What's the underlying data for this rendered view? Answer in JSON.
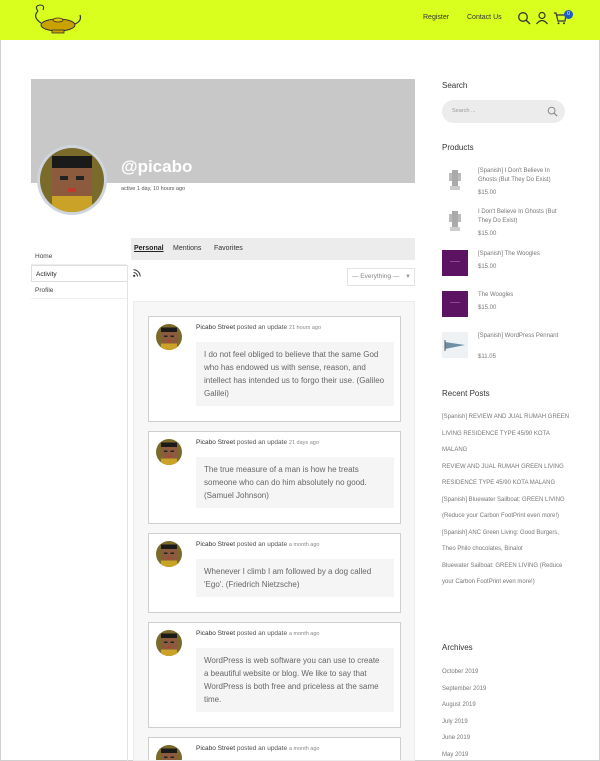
{
  "header": {
    "register_label": "Register",
    "contact_label": "Contact Us",
    "cart_count": "0"
  },
  "profile": {
    "username": "@picabo",
    "active": "active 1 day, 10 hours ago"
  },
  "side_menu": [
    "Home",
    "Activity",
    "Profile"
  ],
  "subnav": {
    "personal": "Personal",
    "mentions": "Mentions",
    "favorites": "Favorites"
  },
  "filter": {
    "value": "— Everything —"
  },
  "activity": [
    {
      "name": "Picabo Street",
      "action": "posted an update",
      "time": "21 hours ago",
      "text": "I do not feel obliged to believe that the same God who has endowed us with sense, reason, and intellect has intended us to forgo their use. (Galileo Galilei)"
    },
    {
      "name": "Picabo Street",
      "action": "posted an update",
      "time": "21 days ago",
      "text": "The true measure of a man is how he treats someone who can do him absolutely no good. (Samuel Johnson)"
    },
    {
      "name": "Picabo Street",
      "action": "posted an update",
      "time": "a month ago",
      "text": "Whenever I climb I am followed by a dog called 'Ego'. (Friedrich Nietzsche)"
    },
    {
      "name": "Picabo Street",
      "action": "posted an update",
      "time": "a month ago",
      "text": "WordPress is web software you can use to create a beautiful website or blog. We like to say that WordPress is both free and priceless at the same time."
    },
    {
      "name": "Picabo Street",
      "action": "posted an update",
      "time": "a month ago",
      "text": ""
    }
  ],
  "sidebar": {
    "search_title": "Search",
    "search_placeholder": "Search ...",
    "products_title": "Products",
    "products": [
      {
        "name": "[Spanish] I Don't Believe In Ghosts (But They Do Exist)",
        "price": "$15.00",
        "thumb": "figure"
      },
      {
        "name": "I Don't Believe In Ghosts (But They Do Exist)",
        "price": "$15.00",
        "thumb": "figure"
      },
      {
        "name": "[Spanish] The Woogles",
        "price": "$15.00",
        "thumb": "purple"
      },
      {
        "name": "The Woogles",
        "price": "$15.00",
        "thumb": "purple"
      },
      {
        "name": "[Spanish] WordPress Pennant",
        "price": "$11.05",
        "thumb": "pennant"
      }
    ],
    "recent_title": "Recent Posts",
    "recent_posts": [
      "[Spanish] REVIEW AND JUAL RUMAH GREEN LIVING RESIDENCE TYPE 45/90 KOTA MALANG",
      "REVIEW AND JUAL RUMAH GREEN LIVING RESIDENCE TYPE 45/90 KOTA MALANG",
      "[Spanish] Bluewater Sailboat: GREEN LIVING (Reduce your Carbon FootPrint even more!)",
      "[Spanish] ANC Green Living: Good Burgers, Theo Philo chocolates, Binalot",
      "Bluewater Sailboat: GREEN LIVING (Reduce your Carbon FootPrint even more!)"
    ],
    "archives_title": "Archives",
    "archives": [
      "October 2019",
      "September 2019",
      "August 2019",
      "July 2019",
      "June 2019",
      "May 2019"
    ]
  },
  "colors": {
    "header_bg": "#d9ff1f",
    "badge": "#1e5bc6",
    "cover": "#c8c8c8"
  }
}
